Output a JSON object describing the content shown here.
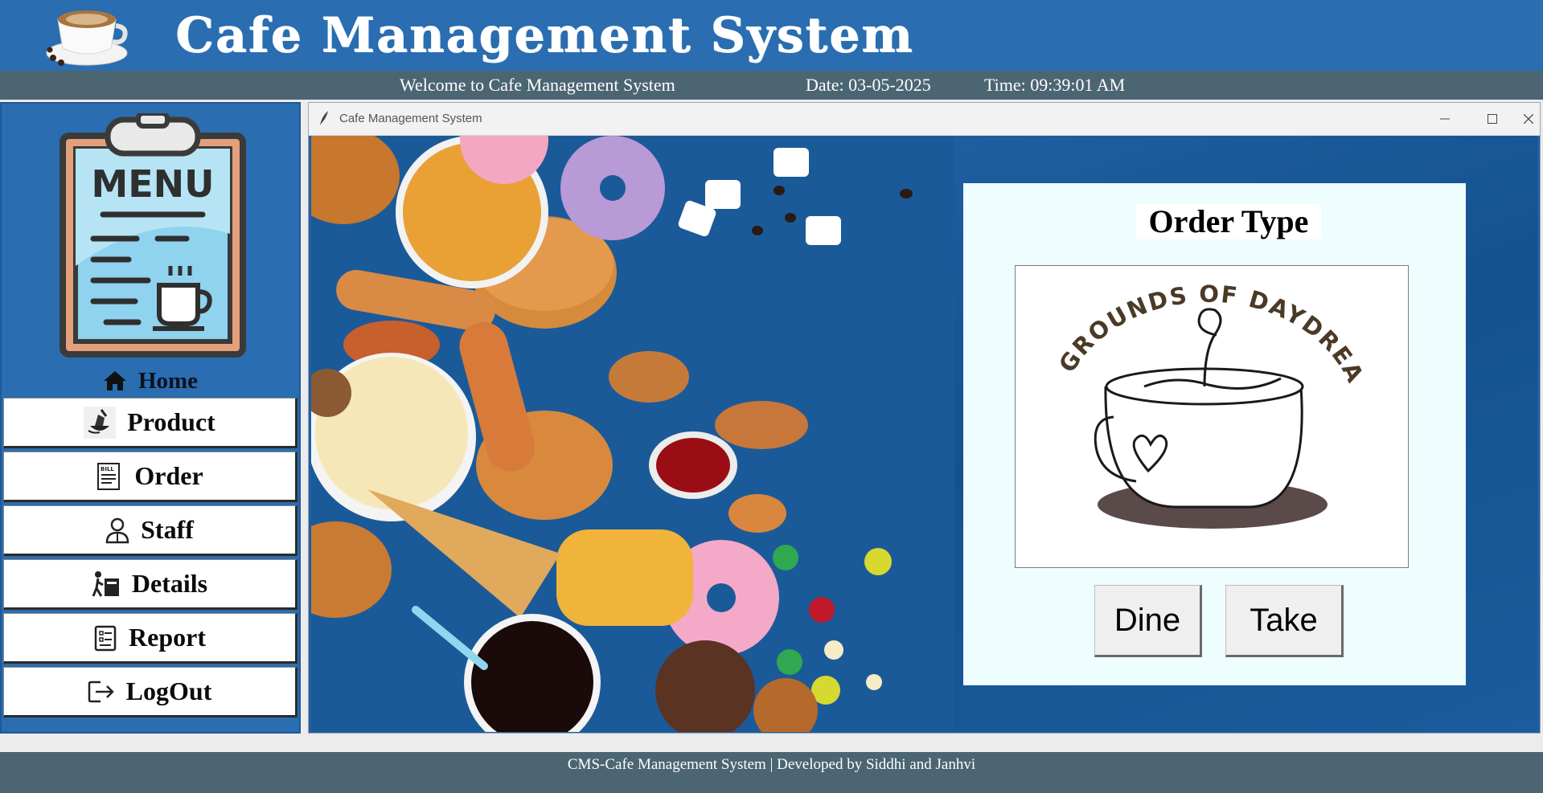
{
  "header": {
    "title": "Cafe Management System",
    "logo_icon": "coffee-cup-icon"
  },
  "infobar": {
    "welcome": "Welcome to Cafe Management System",
    "date": "Date: 03-05-2025",
    "time": "Time: 09:39:01 AM"
  },
  "sidebar": {
    "menu_board": {
      "text": "MENU",
      "icon": "menu-board-icon"
    },
    "home": {
      "label": "Home",
      "icon": "home-icon"
    },
    "items": [
      {
        "label": "Product",
        "icon": "product-icon"
      },
      {
        "label": "Order",
        "icon": "bill-icon"
      },
      {
        "label": "Staff",
        "icon": "staff-icon"
      },
      {
        "label": "Details",
        "icon": "details-icon"
      },
      {
        "label": "Report",
        "icon": "report-icon"
      },
      {
        "label": "LogOut",
        "icon": "logout-icon"
      }
    ]
  },
  "window": {
    "title": "Cafe Management System",
    "controls": [
      "minimize",
      "maximize",
      "close"
    ]
  },
  "order_panel": {
    "title": "Order Type",
    "logo_text": "GROUNDS OF DAYDREAM",
    "dine_label": "Dine",
    "take_label": "Take"
  },
  "footer": {
    "text": "CMS-Cafe Management System | Developed by Siddhi and Janhvi"
  },
  "colors": {
    "header_bg": "#2a6db0",
    "infobar_bg": "#4c6573",
    "panel_bg": "#eefdfd",
    "content_bg": "#1a5c9c"
  }
}
